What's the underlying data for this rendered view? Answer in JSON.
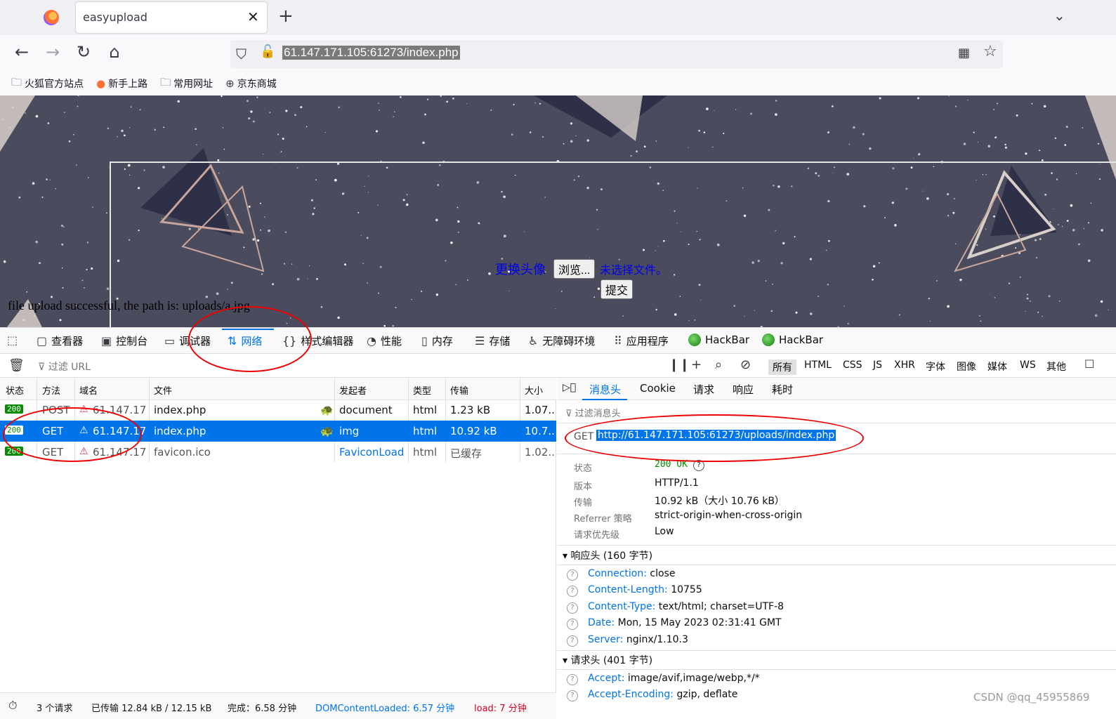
{
  "browser": {
    "tab_title": "easyupload",
    "url": "61.147.171.105:61273/index.php",
    "bookmarks": [
      "火狐官方站点",
      "新手上路",
      "常用网址",
      "京东商城"
    ]
  },
  "page": {
    "upload_label": "更换头像",
    "browse_button": "浏览...",
    "no_file": "未选择文件。",
    "submit_button": "提交",
    "success_message": "file upload successful, the path is: uploads/a.jpg"
  },
  "devtools": {
    "tabs": [
      "查看器",
      "控制台",
      "调试器",
      "网络",
      "样式编辑器",
      "性能",
      "内存",
      "存储",
      "无障碍环境",
      "应用程序",
      "HackBar",
      "HackBar"
    ],
    "filter_placeholder": "过滤 URL",
    "type_filters": [
      "所有",
      "HTML",
      "CSS",
      "JS",
      "XHR",
      "字体",
      "图像",
      "媒体",
      "WS",
      "其他"
    ],
    "columns": [
      "状态",
      "方法",
      "域名",
      "文件",
      "发起者",
      "类型",
      "传输",
      "大小"
    ],
    "requests": [
      {
        "status": "200",
        "method": "POST",
        "domain": "61.147.17...",
        "file": "index.php",
        "initiator": "document",
        "type": "html",
        "transferred": "1.23 kB",
        "size": "1.07..."
      },
      {
        "status": "200",
        "method": "GET",
        "domain": "61.147.17...",
        "file": "index.php",
        "initiator": "img",
        "type": "html",
        "transferred": "10.92 kB",
        "size": "10.7..."
      },
      {
        "status": "200",
        "method": "GET",
        "domain": "61.147.17...",
        "file": "favicon.ico",
        "initiator": "FaviconLoad...",
        "type": "html",
        "transferred": "已缓存",
        "size": "1.02..."
      }
    ],
    "detail_tabs": [
      "消息头",
      "Cookie",
      "请求",
      "响应",
      "耗时"
    ],
    "filter_headers": "过滤消息头",
    "request_method": "GET",
    "request_url": "http://61.147.171.105:61273/uploads/index.php",
    "summary": [
      {
        "key": "状态",
        "value": "200 OK"
      },
      {
        "key": "版本",
        "value": "HTTP/1.1"
      },
      {
        "key": "传输",
        "value": "10.92 kB（大小 10.76 kB）"
      },
      {
        "key": "Referrer 策略",
        "value": "strict-origin-when-cross-origin"
      },
      {
        "key": "请求优先级",
        "value": "Low"
      }
    ],
    "response_headers_title": "响应头 (160 字节)",
    "response_headers": [
      {
        "name": "Connection:",
        "value": "close"
      },
      {
        "name": "Content-Length:",
        "value": "10755"
      },
      {
        "name": "Content-Type:",
        "value": "text/html; charset=UTF-8"
      },
      {
        "name": "Date:",
        "value": "Mon, 15 May 2023 02:31:41 GMT"
      },
      {
        "name": "Server:",
        "value": "nginx/1.10.3"
      }
    ],
    "request_headers_title": "请求头 (401 字节)",
    "request_headers": [
      {
        "name": "Accept:",
        "value": "image/avif,image/webp,*/*"
      },
      {
        "name": "Accept-Encoding:",
        "value": "gzip, deflate"
      }
    ],
    "statusbar": {
      "requests": "3 个请求",
      "transferred": "已传输 12.84 kB / 12.15 kB",
      "finish": "完成：6.58 分钟",
      "dom": "DOMContentLoaded: 6.57 分钟",
      "load": "load: 7 分钟"
    }
  },
  "watermark": "CSDN @qq_45955869",
  "colors": {
    "accent": "#0074e8",
    "status_ok": "#058b00",
    "annotation": "#ee0000",
    "page_bg": "#4a4b5c"
  }
}
